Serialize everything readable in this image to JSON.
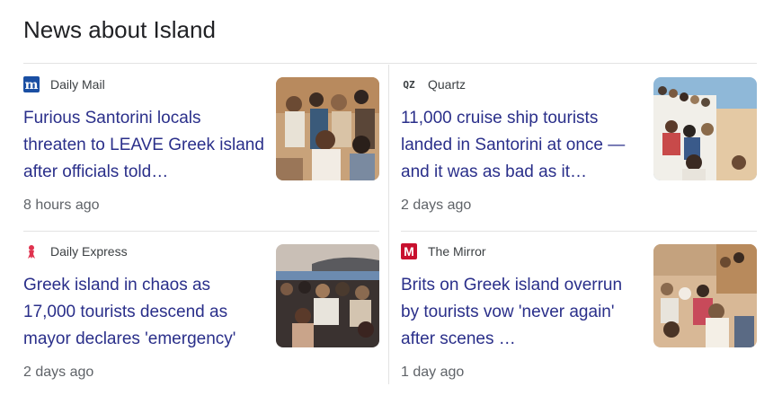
{
  "heading": "News about Island",
  "cards": [
    {
      "source": "Daily Mail",
      "logo_icon": "daily-mail-logo-icon",
      "title": "Furious Santorini locals threaten to LEAVE Greek island after officials told…",
      "time": "8 hours ago"
    },
    {
      "source": "Quartz",
      "logo_text": "QZ",
      "logo_icon": "quartz-logo-icon",
      "title": "11,000 cruise ship tourists landed in Santorini at once — and it was as bad as it…",
      "time": "2 days ago"
    },
    {
      "source": "Daily Express",
      "logo_icon": "daily-express-logo-icon",
      "title": "Greek island in chaos as 17,000 tourists descend as mayor declares 'emergency'",
      "time": "2 days ago"
    },
    {
      "source": "The Mirror",
      "logo_text": "M",
      "logo_icon": "the-mirror-logo-icon",
      "title": "Brits on Greek island overrun by tourists vow 'never again' after scenes …",
      "time": "1 day ago"
    }
  ],
  "colors": {
    "title_link": "#2a2f8a",
    "daily_mail_blue": "#1a4fa3",
    "mirror_red": "#c8102e",
    "express_red": "#e0334f"
  }
}
